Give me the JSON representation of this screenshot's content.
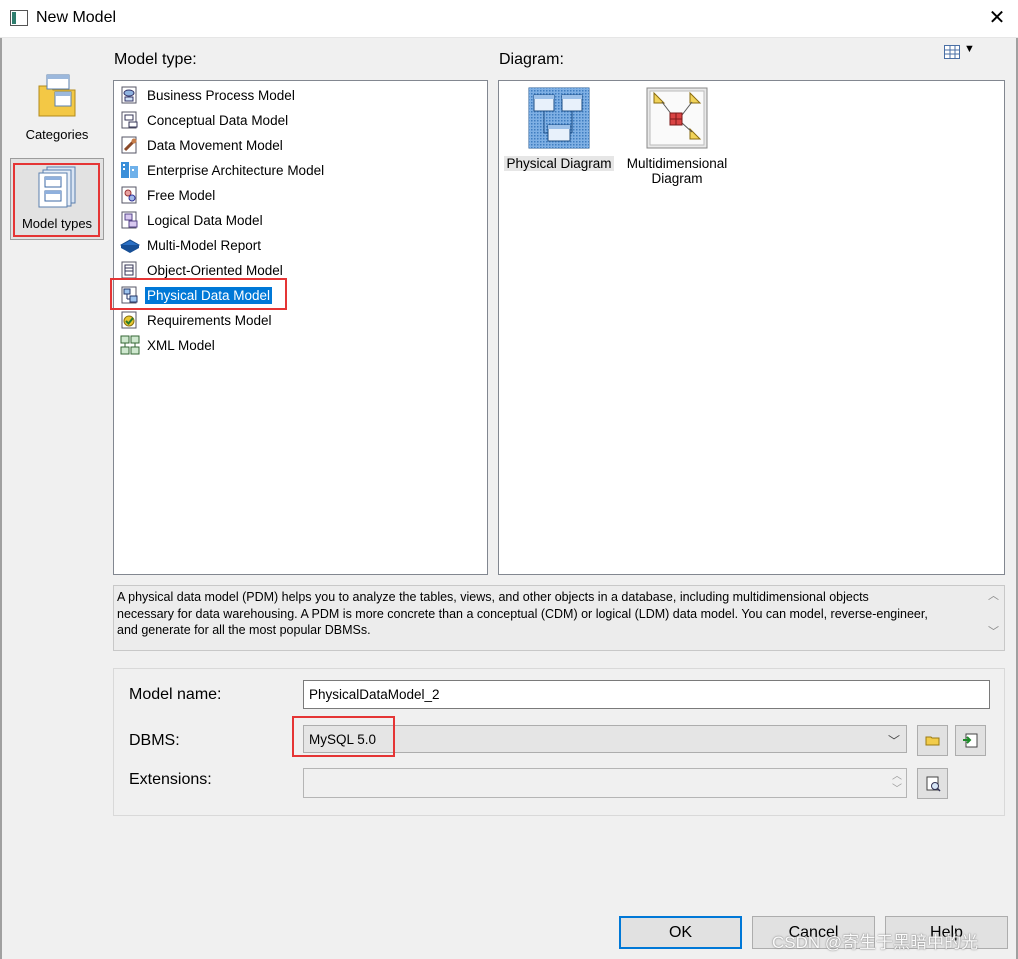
{
  "window": {
    "title": "New Model"
  },
  "categories": {
    "items": [
      {
        "label": "Categories"
      },
      {
        "label": "Model types"
      }
    ]
  },
  "model_type": {
    "label": "Model type:",
    "items": [
      {
        "label": "Business Process Model",
        "icon": "business-process-model-icon"
      },
      {
        "label": "Conceptual Data Model",
        "icon": "conceptual-data-model-icon"
      },
      {
        "label": "Data Movement Model",
        "icon": "data-movement-model-icon"
      },
      {
        "label": "Enterprise Architecture Model",
        "icon": "enterprise-architecture-model-icon"
      },
      {
        "label": "Free Model",
        "icon": "free-model-icon"
      },
      {
        "label": "Logical Data Model",
        "icon": "logical-data-model-icon"
      },
      {
        "label": "Multi-Model Report",
        "icon": "multi-model-report-icon"
      },
      {
        "label": "Object-Oriented Model",
        "icon": "object-oriented-model-icon"
      },
      {
        "label": "Physical Data Model",
        "icon": "physical-data-model-icon",
        "selected": true
      },
      {
        "label": "Requirements Model",
        "icon": "requirements-model-icon"
      },
      {
        "label": "XML Model",
        "icon": "xml-model-icon"
      }
    ]
  },
  "diagram": {
    "label": "Diagram:",
    "items": [
      {
        "label": "Physical Diagram",
        "icon": "physical-diagram-icon",
        "selected": true
      },
      {
        "label_line1": "Multidimensional",
        "label_line2": "Diagram",
        "icon": "multidimensional-diagram-icon"
      }
    ]
  },
  "description": {
    "line1": "A physical data model (PDM) helps you to analyze the tables, views, and other objects in a database, including multidimensional objects",
    "line2": "necessary for data warehousing. A PDM is more concrete than a conceptual (CDM) or logical (LDM) data model. You can model, reverse-engineer,",
    "line3": "and generate for all the most popular DBMSs."
  },
  "form": {
    "model_name_label": "Model name:",
    "model_name_value": "PhysicalDataModel_2",
    "dbms_label": "DBMS:",
    "dbms_value": "MySQL 5.0",
    "extensions_label": "Extensions:",
    "extensions_value": ""
  },
  "buttons": {
    "ok": "OK",
    "cancel": "Cancel",
    "help": "Help"
  },
  "watermark": "CSDN @寄生于黑暗中的光",
  "colors": {
    "selection": "#0078d7",
    "highlight_box": "#e53535"
  }
}
